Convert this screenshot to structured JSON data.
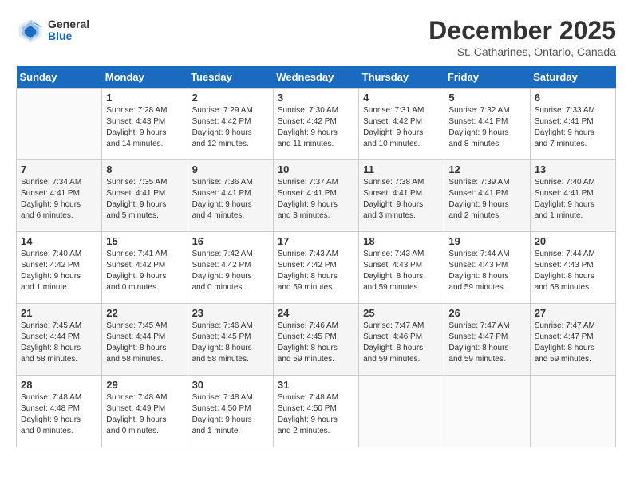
{
  "header": {
    "logo_line1": "General",
    "logo_line2": "Blue",
    "month_title": "December 2025",
    "location": "St. Catharines, Ontario, Canada"
  },
  "days_of_week": [
    "Sunday",
    "Monday",
    "Tuesday",
    "Wednesday",
    "Thursday",
    "Friday",
    "Saturday"
  ],
  "weeks": [
    [
      {
        "day": "",
        "info": ""
      },
      {
        "day": "1",
        "info": "Sunrise: 7:28 AM\nSunset: 4:43 PM\nDaylight: 9 hours\nand 14 minutes."
      },
      {
        "day": "2",
        "info": "Sunrise: 7:29 AM\nSunset: 4:42 PM\nDaylight: 9 hours\nand 12 minutes."
      },
      {
        "day": "3",
        "info": "Sunrise: 7:30 AM\nSunset: 4:42 PM\nDaylight: 9 hours\nand 11 minutes."
      },
      {
        "day": "4",
        "info": "Sunrise: 7:31 AM\nSunset: 4:42 PM\nDaylight: 9 hours\nand 10 minutes."
      },
      {
        "day": "5",
        "info": "Sunrise: 7:32 AM\nSunset: 4:41 PM\nDaylight: 9 hours\nand 8 minutes."
      },
      {
        "day": "6",
        "info": "Sunrise: 7:33 AM\nSunset: 4:41 PM\nDaylight: 9 hours\nand 7 minutes."
      }
    ],
    [
      {
        "day": "7",
        "info": "Sunrise: 7:34 AM\nSunset: 4:41 PM\nDaylight: 9 hours\nand 6 minutes."
      },
      {
        "day": "8",
        "info": "Sunrise: 7:35 AM\nSunset: 4:41 PM\nDaylight: 9 hours\nand 5 minutes."
      },
      {
        "day": "9",
        "info": "Sunrise: 7:36 AM\nSunset: 4:41 PM\nDaylight: 9 hours\nand 4 minutes."
      },
      {
        "day": "10",
        "info": "Sunrise: 7:37 AM\nSunset: 4:41 PM\nDaylight: 9 hours\nand 3 minutes."
      },
      {
        "day": "11",
        "info": "Sunrise: 7:38 AM\nSunset: 4:41 PM\nDaylight: 9 hours\nand 3 minutes."
      },
      {
        "day": "12",
        "info": "Sunrise: 7:39 AM\nSunset: 4:41 PM\nDaylight: 9 hours\nand 2 minutes."
      },
      {
        "day": "13",
        "info": "Sunrise: 7:40 AM\nSunset: 4:41 PM\nDaylight: 9 hours\nand 1 minute."
      }
    ],
    [
      {
        "day": "14",
        "info": "Sunrise: 7:40 AM\nSunset: 4:42 PM\nDaylight: 9 hours\nand 1 minute."
      },
      {
        "day": "15",
        "info": "Sunrise: 7:41 AM\nSunset: 4:42 PM\nDaylight: 9 hours\nand 0 minutes."
      },
      {
        "day": "16",
        "info": "Sunrise: 7:42 AM\nSunset: 4:42 PM\nDaylight: 9 hours\nand 0 minutes."
      },
      {
        "day": "17",
        "info": "Sunrise: 7:43 AM\nSunset: 4:42 PM\nDaylight: 8 hours\nand 59 minutes."
      },
      {
        "day": "18",
        "info": "Sunrise: 7:43 AM\nSunset: 4:43 PM\nDaylight: 8 hours\nand 59 minutes."
      },
      {
        "day": "19",
        "info": "Sunrise: 7:44 AM\nSunset: 4:43 PM\nDaylight: 8 hours\nand 59 minutes."
      },
      {
        "day": "20",
        "info": "Sunrise: 7:44 AM\nSunset: 4:43 PM\nDaylight: 8 hours\nand 58 minutes."
      }
    ],
    [
      {
        "day": "21",
        "info": "Sunrise: 7:45 AM\nSunset: 4:44 PM\nDaylight: 8 hours\nand 58 minutes."
      },
      {
        "day": "22",
        "info": "Sunrise: 7:45 AM\nSunset: 4:44 PM\nDaylight: 8 hours\nand 58 minutes."
      },
      {
        "day": "23",
        "info": "Sunrise: 7:46 AM\nSunset: 4:45 PM\nDaylight: 8 hours\nand 58 minutes."
      },
      {
        "day": "24",
        "info": "Sunrise: 7:46 AM\nSunset: 4:45 PM\nDaylight: 8 hours\nand 59 minutes."
      },
      {
        "day": "25",
        "info": "Sunrise: 7:47 AM\nSunset: 4:46 PM\nDaylight: 8 hours\nand 59 minutes."
      },
      {
        "day": "26",
        "info": "Sunrise: 7:47 AM\nSunset: 4:47 PM\nDaylight: 8 hours\nand 59 minutes."
      },
      {
        "day": "27",
        "info": "Sunrise: 7:47 AM\nSunset: 4:47 PM\nDaylight: 8 hours\nand 59 minutes."
      }
    ],
    [
      {
        "day": "28",
        "info": "Sunrise: 7:48 AM\nSunset: 4:48 PM\nDaylight: 9 hours\nand 0 minutes."
      },
      {
        "day": "29",
        "info": "Sunrise: 7:48 AM\nSunset: 4:49 PM\nDaylight: 9 hours\nand 0 minutes."
      },
      {
        "day": "30",
        "info": "Sunrise: 7:48 AM\nSunset: 4:50 PM\nDaylight: 9 hours\nand 1 minute."
      },
      {
        "day": "31",
        "info": "Sunrise: 7:48 AM\nSunset: 4:50 PM\nDaylight: 9 hours\nand 2 minutes."
      },
      {
        "day": "",
        "info": ""
      },
      {
        "day": "",
        "info": ""
      },
      {
        "day": "",
        "info": ""
      }
    ]
  ]
}
